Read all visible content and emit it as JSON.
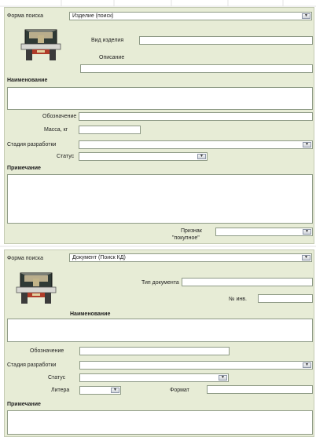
{
  "panel1": {
    "search_form_label": "Форма поиска",
    "search_form_value": "Изделие (поиск)",
    "product_type_label": "Вид изделия",
    "description_label": "Описание",
    "name_label": "Наименование",
    "designation_label": "Обозначение",
    "mass_label": "Масса, кг",
    "stage_label": "Стадия разработки",
    "status_label": "Статус",
    "note_label": "Примечание",
    "purchased_label_line1": "Признак",
    "purchased_label_line2": "\"покупное\""
  },
  "panel2": {
    "search_form_label": "Форма поиска",
    "search_form_value": "Документ (Поиск КД)",
    "doc_type_label": "Тип документа",
    "inv_label": "№ инв.",
    "name_label": "Наименование",
    "designation_label": "Обозначение",
    "stage_label": "Стадия разработки",
    "status_label": "Статус",
    "litera_label": "Литера",
    "format_label": "Формат",
    "note_label": "Примечание"
  },
  "icons": {
    "product_icon": "desk-lamp-icon",
    "document_icon": "desk-lamp-icon",
    "dropdown_icon": "chevron-down-icon"
  },
  "colors": {
    "panel_bg": "#e7ecd6",
    "field_bg": "#ffffff",
    "field_border": "#8e9a86"
  }
}
